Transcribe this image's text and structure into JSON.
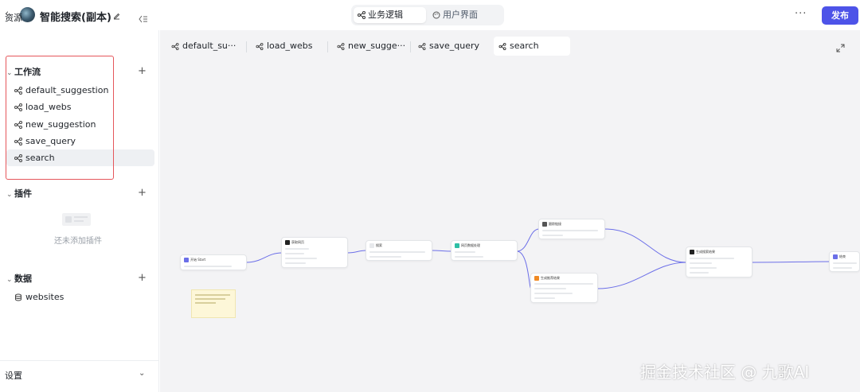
{
  "header": {
    "title": "智能搜索(副本)",
    "tabs": [
      {
        "label": "业务逻辑",
        "icon": "workflow-icon",
        "active": true
      },
      {
        "label": "用户界面",
        "icon": "palette-icon",
        "active": false
      }
    ],
    "more_label": "···",
    "publish_label": "发布",
    "accent": "#4d53e8"
  },
  "sidebar": {
    "heading": "资源",
    "workflow": {
      "title": "工作流",
      "items": [
        {
          "label": "default_suggestion"
        },
        {
          "label": "load_webs"
        },
        {
          "label": "new_suggestion"
        },
        {
          "label": "save_query"
        },
        {
          "label": "search",
          "selected": true
        }
      ]
    },
    "plugins": {
      "title": "插件",
      "empty_text": "还未添加插件"
    },
    "data": {
      "title": "数据",
      "items": [
        {
          "label": "websites"
        }
      ]
    },
    "settings_label": "设置"
  },
  "canvas": {
    "tabs": [
      {
        "label": "default_su···"
      },
      {
        "label": "load_webs"
      },
      {
        "label": "new_sugge···"
      },
      {
        "label": "save_query"
      },
      {
        "label": "search",
        "active": true
      }
    ],
    "node_titles": {
      "start": "开始 Start",
      "n1": "获取网页",
      "n2": "搜索",
      "n3": "网页数据处理",
      "n4": "跟踪链接",
      "n5": "生成搜索结果",
      "n6": "生成推荐结果",
      "end": "结束"
    },
    "highlight_color": "#e5565b"
  },
  "watermark": "掘金技术社区 @ 九歌AI"
}
